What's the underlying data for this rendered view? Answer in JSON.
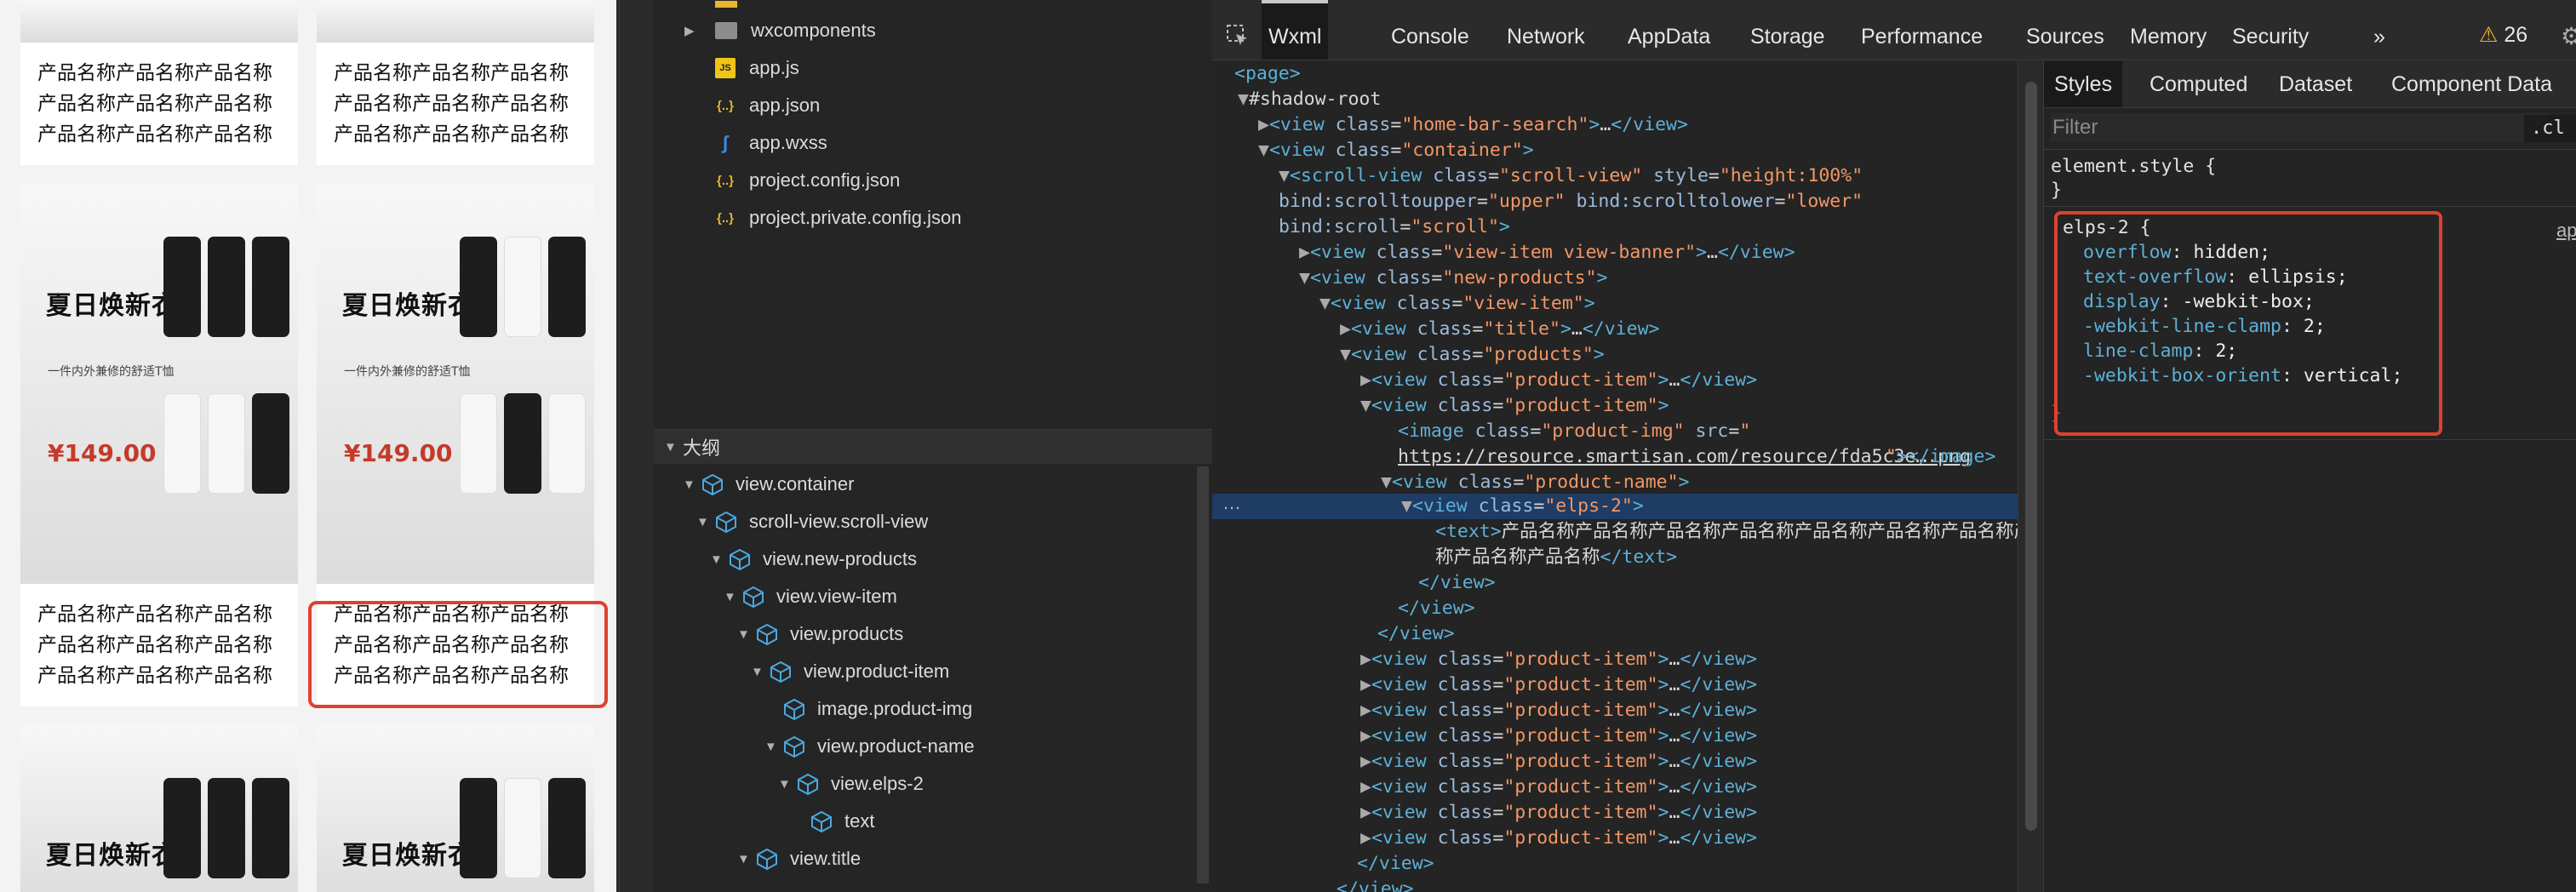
{
  "simulator": {
    "product_text": "产品名称产品名称产品名称产品名称产品名称产品名称产品名称产品名称产品名称产品名称",
    "promo_title": "夏日焕新衣",
    "promo_subtitle": "一件内外兼修的舒适T恤",
    "promo_price": "¥149.00"
  },
  "file_tree": {
    "items": [
      {
        "label": "wxcomponents",
        "icon": "folder-icon"
      },
      {
        "label": "app.js",
        "icon": "js-file-icon",
        "badge": "JS"
      },
      {
        "label": "app.json",
        "icon": "json-file-icon",
        "badge": "{..}"
      },
      {
        "label": "app.wxss",
        "icon": "wxss-file-icon"
      },
      {
        "label": "project.config.json",
        "icon": "json-file-icon",
        "badge": "{..}"
      },
      {
        "label": "project.private.config.json",
        "icon": "json-file-icon",
        "badge": "{..}"
      }
    ]
  },
  "outline": {
    "title": "大纲",
    "items": [
      {
        "label": "view.container"
      },
      {
        "label": "scroll-view.scroll-view"
      },
      {
        "label": "view.new-products"
      },
      {
        "label": "view.view-item"
      },
      {
        "label": "view.products"
      },
      {
        "label": "view.product-item"
      },
      {
        "label": "image.product-img"
      },
      {
        "label": "view.product-name"
      },
      {
        "label": "view.elps-2"
      },
      {
        "label": "text"
      },
      {
        "label": "view.title"
      }
    ]
  },
  "devtools": {
    "tabs": [
      "Wxml",
      "Console",
      "Network",
      "AppData",
      "Storage",
      "Performance",
      "Sources",
      "Memory",
      "Security"
    ],
    "more_tabs": "»",
    "warning_count": "26",
    "warning_icon": "⚠",
    "dom": {
      "page_open": "<page>",
      "shadow_root": "#shadow-root",
      "ellipsis": "…",
      "product_img_src": "https://resource.smartisan.com/resource/fda5c3e….png",
      "text_content": "产品名称产品名称产品名称产品名称产品名称产品名称产品名称产品名称",
      "text_close": "</text>",
      "view_close": "</view>",
      "more_dots": "…"
    },
    "styles": {
      "subtabs": [
        "Styles",
        "Computed",
        "Dataset",
        "Component Data"
      ],
      "filter_placeholder": "Filter",
      "cls_label": ".cl",
      "element_style_open": "element.style {",
      "close_brace": "}",
      "selector": "elps-2 {",
      "source": "app",
      "props": [
        {
          "name": "overflow",
          "value": "hidden;"
        },
        {
          "name": "text-overflow",
          "value": "ellipsis;"
        },
        {
          "name": "display",
          "value": "-webkit-box;"
        },
        {
          "name": "-webkit-line-clamp",
          "value": "2;"
        },
        {
          "name": "line-clamp",
          "value": "2;"
        },
        {
          "name": "-webkit-box-orient",
          "value": "vertical;"
        }
      ]
    }
  }
}
